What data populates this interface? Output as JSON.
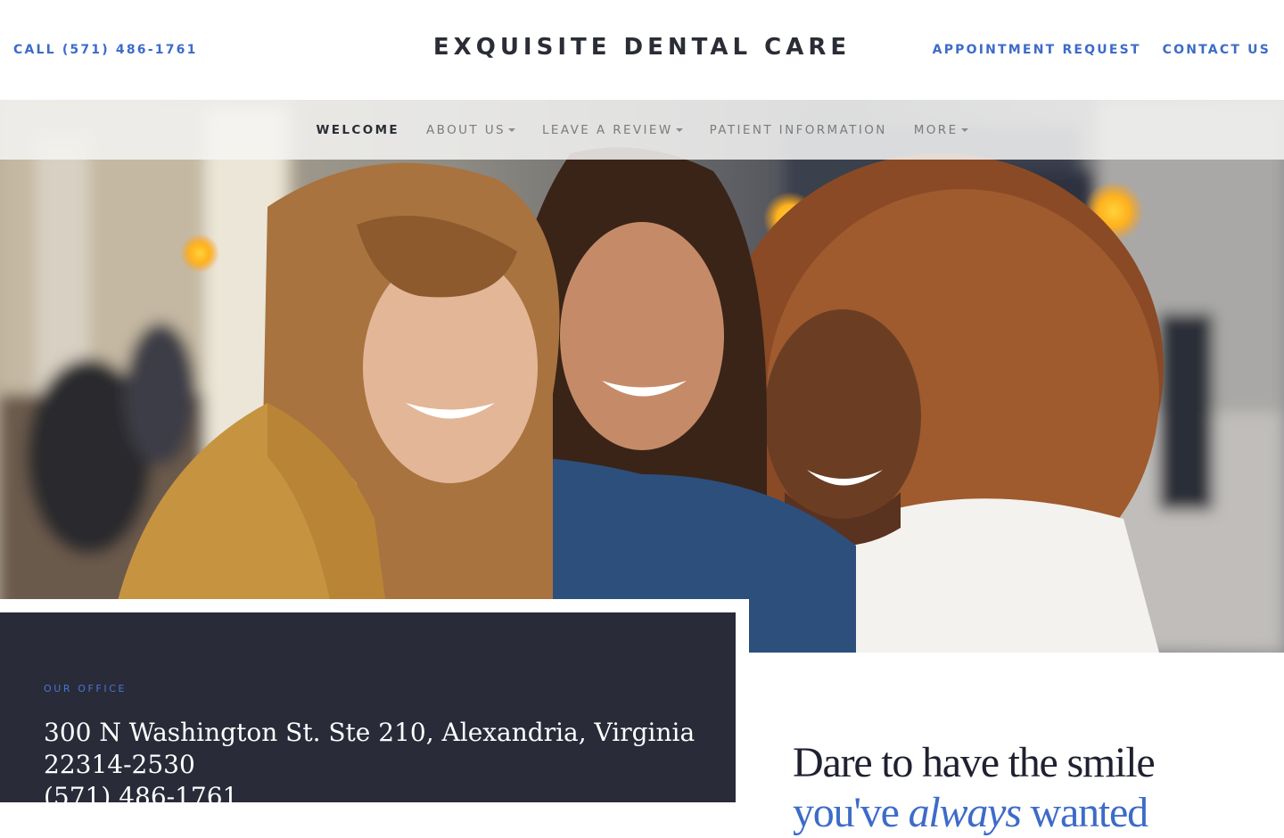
{
  "header": {
    "call_label": "CALL (571) 486-1761",
    "logo": "EXQUISITE DENTAL CARE",
    "links": [
      "APPOINTMENT REQUEST",
      "CONTACT US"
    ]
  },
  "nav": {
    "items": [
      {
        "label": "WELCOME",
        "active": true,
        "dropdown": false
      },
      {
        "label": "ABOUT US",
        "active": false,
        "dropdown": true
      },
      {
        "label": "LEAVE A REVIEW",
        "active": false,
        "dropdown": true
      },
      {
        "label": "PATIENT INFORMATION",
        "active": false,
        "dropdown": false
      },
      {
        "label": "MORE",
        "active": false,
        "dropdown": true
      }
    ]
  },
  "office": {
    "label": "OUR OFFICE",
    "address_line1": "300 N Washington St. Ste 210, Alexandria, Virginia",
    "address_line2": "22314-2530",
    "phone": "(571) 486-1761"
  },
  "tagline": {
    "line1": "Dare to have the smile",
    "line2_pre": "you've ",
    "line2_em": "always",
    "line2_post": " wanted"
  },
  "colors": {
    "accent": "#3d6bc8",
    "dark_card": "#292b39",
    "text_dark": "#2b2d36"
  },
  "icons": [
    "caret-down-icon"
  ]
}
